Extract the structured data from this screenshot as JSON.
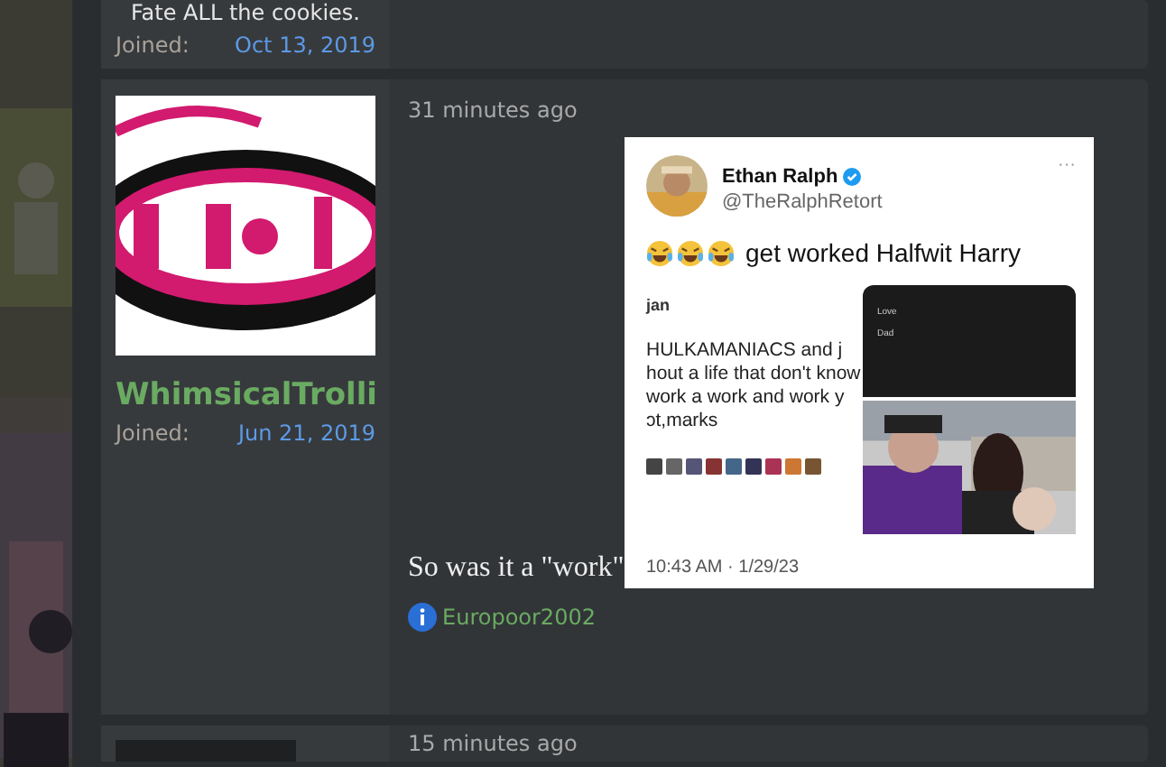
{
  "previous_post": {
    "signature": "Fate ALL the cookies.",
    "joined_label": "Joined:",
    "joined_date": "Oct 13, 2019"
  },
  "post": {
    "username": "WhimsicalTrolli",
    "joined_label": "Joined:",
    "joined_date": "Jun 21, 2019",
    "time": "31 minutes ago",
    "tweet": {
      "author": "Ethan Ralph",
      "handle": "@TheRalphRetort",
      "menu": "···",
      "text": "get worked Halfwit Harry",
      "quoted": {
        "name": "jan",
        "lines": [
          "HULKAMANIACS and j",
          "hout a life that don't know",
          "work a work and work y",
          "ɔt,marks"
        ]
      },
      "message_lines": [
        "Love",
        "Dad"
      ],
      "timestamp": "10:43 AM · 1/29/23"
    },
    "message": "So was it a \"work\"",
    "reaction_user": "Europoor2002"
  },
  "next_post": {
    "time": "15 minutes ago"
  }
}
